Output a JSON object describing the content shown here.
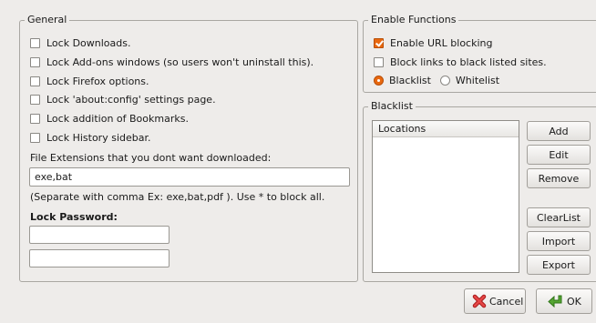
{
  "general": {
    "title": "General",
    "checkboxes": [
      {
        "label": "Lock Downloads.",
        "checked": false
      },
      {
        "label": "Lock Add-ons windows (so users won't uninstall this).",
        "checked": false
      },
      {
        "label": "Lock Firefox options.",
        "checked": false
      },
      {
        "label": "Lock 'about:config' settings page.",
        "checked": false
      },
      {
        "label": "Lock addition of Bookmarks.",
        "checked": false
      },
      {
        "label": "Lock History sidebar.",
        "checked": false
      }
    ],
    "extensions_label": "File Extensions that you dont want downloaded:",
    "extensions_value": "exe,bat",
    "extensions_hint": "(Separate with comma Ex:  exe,bat,pdf ). Use * to block all.",
    "password_label": "Lock Password:",
    "password_value": "",
    "password_confirm_value": ""
  },
  "enable_functions": {
    "title": "Enable Functions",
    "checkboxes": [
      {
        "label": "Enable URL blocking",
        "checked": true
      },
      {
        "label": "Block links to black listed sites.",
        "checked": false
      }
    ],
    "radios": [
      {
        "label": "Blacklist",
        "checked": true
      },
      {
        "label": "Whitelist",
        "checked": false
      }
    ]
  },
  "blacklist": {
    "title": "Blacklist",
    "column_header": "Locations",
    "items": [],
    "buttons": {
      "add": "Add",
      "edit": "Edit",
      "remove": "Remove",
      "clearlist": "ClearList",
      "import": "Import",
      "export": "Export"
    }
  },
  "footer": {
    "cancel_label": "Cancel",
    "ok_label": "OK"
  },
  "colors": {
    "accent": "#e8680f",
    "window_bg": "#eeecea",
    "cancel_icon": "#d8282a",
    "ok_icon": "#55a532"
  },
  "icons": {
    "cancel": "cancel-x-icon",
    "ok": "green-arrow-icon"
  }
}
